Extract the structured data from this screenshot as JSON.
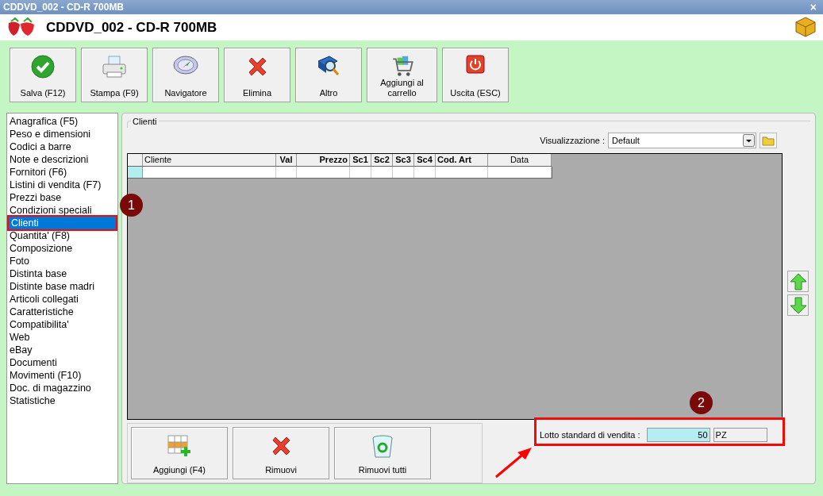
{
  "window": {
    "title": "CDDVD_002 - CD-R 700MB",
    "close": "×"
  },
  "header": {
    "title": "CDDVD_002 - CD-R 700MB"
  },
  "toolbar": [
    {
      "label": "Salva (F12)",
      "kind": "check"
    },
    {
      "label": "Stampa (F9)",
      "kind": "printer"
    },
    {
      "label": "Navigatore",
      "kind": "compass"
    },
    {
      "label": "Elimina",
      "kind": "cross"
    },
    {
      "label": "Altro",
      "kind": "book"
    },
    {
      "label": "Aggiungi al carrello",
      "kind": "cart"
    },
    {
      "label": "Uscita (ESC)",
      "kind": "power"
    }
  ],
  "sidebar": {
    "items": [
      {
        "label": "Anagrafica (F5)",
        "selected": false
      },
      {
        "label": "Peso e dimensioni",
        "selected": false
      },
      {
        "label": "Codici a barre",
        "selected": false
      },
      {
        "label": "Note e descrizioni",
        "selected": false
      },
      {
        "label": "Fornitori (F6)",
        "selected": false
      },
      {
        "label": "Listini di vendita (F7)",
        "selected": false
      },
      {
        "label": "Prezzi base",
        "selected": false
      },
      {
        "label": "Condizioni speciali",
        "selected": false
      },
      {
        "label": "Clienti",
        "selected": true
      },
      {
        "label": "Quantita' (F8)",
        "selected": false
      },
      {
        "label": "Composizione",
        "selected": false
      },
      {
        "label": "Foto",
        "selected": false
      },
      {
        "label": "Distinta base",
        "selected": false
      },
      {
        "label": "Distinte base madri",
        "selected": false
      },
      {
        "label": "Articoli collegati",
        "selected": false
      },
      {
        "label": "Caratteristiche",
        "selected": false
      },
      {
        "label": "Compatibilita'",
        "selected": false
      },
      {
        "label": "Web",
        "selected": false
      },
      {
        "label": "eBay",
        "selected": false
      },
      {
        "label": "Documenti",
        "selected": false
      },
      {
        "label": "Movimenti (F10)",
        "selected": false
      },
      {
        "label": "Doc. di magazzino",
        "selected": false
      },
      {
        "label": "Statistiche",
        "selected": false
      }
    ]
  },
  "panel": {
    "title": "Clienti",
    "view_label": "Visualizzazione :",
    "view_value": "Default"
  },
  "table": {
    "columns": [
      {
        "label": "Cliente"
      },
      {
        "label": "Val"
      },
      {
        "label": "Prezzo"
      },
      {
        "label": "Sc1"
      },
      {
        "label": "Sc2"
      },
      {
        "label": "Sc3"
      },
      {
        "label": "Sc4"
      },
      {
        "label": "Cod. Art"
      },
      {
        "label": "Data"
      }
    ]
  },
  "bottom_buttons": [
    {
      "label": "Aggiungi (F4)",
      "kind": "grid-add"
    },
    {
      "label": "Rimuovi",
      "kind": "cross"
    },
    {
      "label": "Rimuovi tutti",
      "kind": "bin"
    }
  ],
  "lot": {
    "label": "Lotto standard di vendita :",
    "value": "50",
    "unit": "PZ"
  },
  "annotations": [
    {
      "label": "1"
    },
    {
      "label": "2"
    }
  ]
}
